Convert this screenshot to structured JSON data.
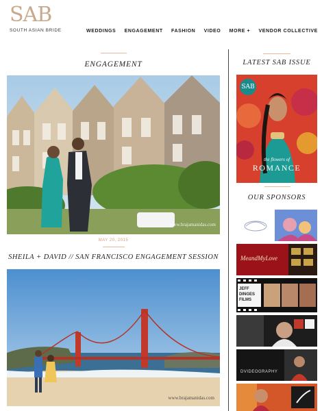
{
  "header": {
    "logo_mark": "SAB",
    "logo_tagline": "SOUTH ASIAN BRIDE",
    "nav": [
      "WEDDINGS",
      "ENGAGEMENT",
      "FASHION",
      "VIDEO",
      "MORE +",
      "VENDOR COLLECTIVE"
    ]
  },
  "main": {
    "section_title": "ENGAGEMENT",
    "post": {
      "date": "MAY 20, 2015",
      "title": "SHEILA + DAVID // SAN FRANCISCO ENGAGEMENT SESSION",
      "photo1_watermark": "www.brajamanidas.com",
      "photo2_watermark": "www.brajamanidas.com"
    }
  },
  "sidebar": {
    "issue_title": "LATEST SAB ISSUE",
    "cover": {
      "badge": "SAB",
      "small": "the flowers of",
      "big": "ROMANCE"
    },
    "sponsors_title": "OUR SPONSORS",
    "sponsors": [
      {
        "label": ""
      },
      {
        "label": "MeandMyLove"
      },
      {
        "label": "JEFF DINGES FILMS"
      },
      {
        "label": ""
      },
      {
        "label": "DVIDEOGRAPHY"
      },
      {
        "label": ""
      }
    ]
  },
  "colors": {
    "accent": "#e7b99a",
    "logo": "#c9a98b",
    "divider": "#444444"
  }
}
